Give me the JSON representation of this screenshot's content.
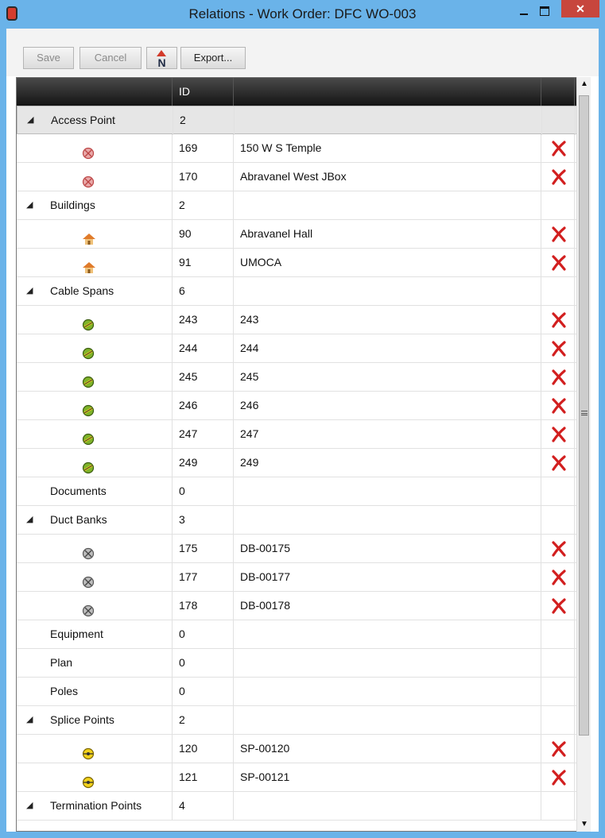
{
  "window": {
    "title": "Relations - Work Order: DFC WO-003",
    "close_glyph": "✕"
  },
  "toolbar": {
    "save_label": "Save",
    "cancel_label": "Cancel",
    "n_label": "N",
    "export_label": "Export..."
  },
  "grid": {
    "header_id": "ID"
  },
  "scrollbar": {
    "up_glyph": "▲",
    "down_glyph": "▼"
  },
  "rows": [
    {
      "kind": "cat",
      "expanded": true,
      "label": "Access Point",
      "count": "2",
      "selected": true
    },
    {
      "kind": "item",
      "icon": "access-point-icon",
      "id": "169",
      "name": "150 W S Temple"
    },
    {
      "kind": "item",
      "icon": "access-point-icon",
      "id": "170",
      "name": "Abravanel West JBox"
    },
    {
      "kind": "cat",
      "expanded": true,
      "label": "Buildings",
      "count": "2"
    },
    {
      "kind": "item",
      "icon": "building-icon",
      "id": "90",
      "name": "Abravanel Hall"
    },
    {
      "kind": "item",
      "icon": "building-icon",
      "id": "91",
      "name": "UMOCA"
    },
    {
      "kind": "cat",
      "expanded": true,
      "label": "Cable Spans",
      "count": "6"
    },
    {
      "kind": "item",
      "icon": "cable-span-icon",
      "id": "243",
      "name": "243"
    },
    {
      "kind": "item",
      "icon": "cable-span-icon",
      "id": "244",
      "name": "244"
    },
    {
      "kind": "item",
      "icon": "cable-span-icon",
      "id": "245",
      "name": "245"
    },
    {
      "kind": "item",
      "icon": "cable-span-icon",
      "id": "246",
      "name": "246"
    },
    {
      "kind": "item",
      "icon": "cable-span-icon",
      "id": "247",
      "name": "247"
    },
    {
      "kind": "item",
      "icon": "cable-span-icon",
      "id": "249",
      "name": "249"
    },
    {
      "kind": "cat",
      "expanded": false,
      "label": "Documents",
      "count": "0"
    },
    {
      "kind": "cat",
      "expanded": true,
      "label": "Duct Banks",
      "count": "3"
    },
    {
      "kind": "item",
      "icon": "duct-bank-icon",
      "id": "175",
      "name": "DB-00175"
    },
    {
      "kind": "item",
      "icon": "duct-bank-icon",
      "id": "177",
      "name": "DB-00177"
    },
    {
      "kind": "item",
      "icon": "duct-bank-icon",
      "id": "178",
      "name": "DB-00178"
    },
    {
      "kind": "cat",
      "expanded": false,
      "label": "Equipment",
      "count": "0"
    },
    {
      "kind": "cat",
      "expanded": false,
      "label": "Plan",
      "count": "0"
    },
    {
      "kind": "cat",
      "expanded": false,
      "label": "Poles",
      "count": "0"
    },
    {
      "kind": "cat",
      "expanded": true,
      "label": "Splice Points",
      "count": "2"
    },
    {
      "kind": "item",
      "icon": "splice-point-icon",
      "id": "120",
      "name": "SP-00120"
    },
    {
      "kind": "item",
      "icon": "splice-point-icon",
      "id": "121",
      "name": "SP-00121"
    },
    {
      "kind": "cat",
      "expanded": true,
      "label": "Termination Points",
      "count": "4"
    }
  ],
  "expander_glyph": "◢",
  "colors": {
    "accent": "#6ab3e9",
    "delete": "#d21f1f",
    "close": "#c7463d"
  }
}
